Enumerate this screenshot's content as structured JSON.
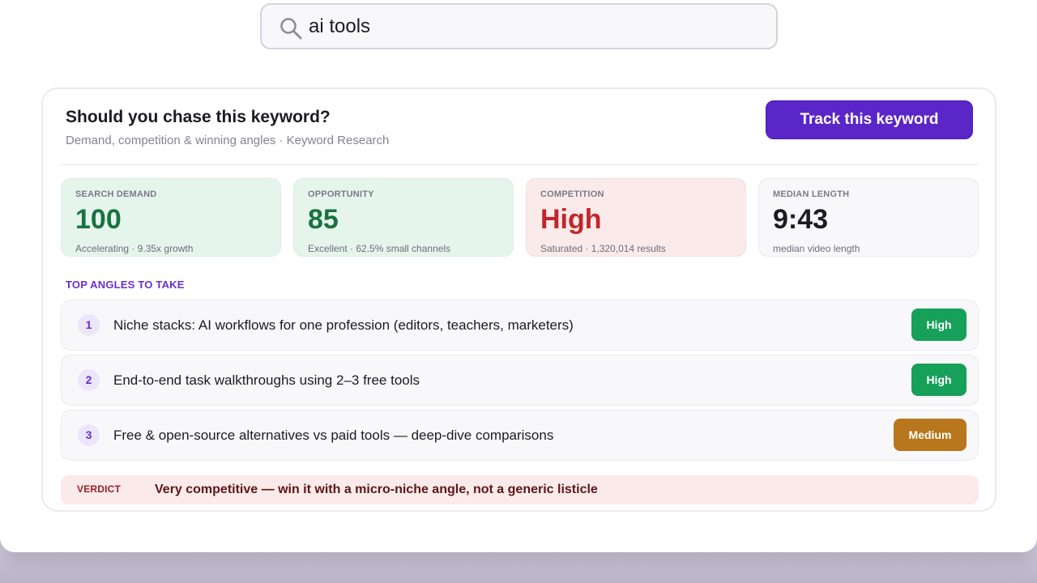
{
  "search": {
    "value": "ai tools",
    "icon": "search-icon"
  },
  "card": {
    "title": "Should you chase this keyword?",
    "subtitle": "Demand, competition & winning angles · Keyword Research",
    "track_button": "Track this keyword"
  },
  "metrics": [
    {
      "label": "SEARCH DEMAND",
      "value": "100",
      "sub": "Accelerating · 9.35x growth",
      "tone": "green"
    },
    {
      "label": "OPPORTUNITY",
      "value": "85",
      "sub": "Excellent · 62.5% small channels",
      "tone": "green"
    },
    {
      "label": "COMPETITION",
      "value": "High",
      "sub": "Saturated · 1,320,014 results",
      "tone": "red"
    },
    {
      "label": "MEDIAN LENGTH",
      "value": "9:43",
      "sub": "median video length",
      "tone": "neutral"
    }
  ],
  "angles": {
    "title": "TOP ANGLES TO TAKE",
    "items": [
      {
        "num": "1",
        "text": "Niche stacks: AI workflows for one profession (editors, teachers, marketers)",
        "badge": "High"
      },
      {
        "num": "2",
        "text": "End-to-end task walkthroughs using 2–3 free tools",
        "badge": "High"
      },
      {
        "num": "3",
        "text": "Free & open-source alternatives vs paid tools — deep-dive comparisons",
        "badge": "Medium"
      }
    ]
  },
  "verdict": {
    "label": "VERDICT",
    "text": "Very competitive — win it with a micro-niche angle, not a generic listicle"
  },
  "colors": {
    "accent": "#5a26c8",
    "positive": "#17733f",
    "negative": "#c0262c",
    "badge_high": "#16a05a",
    "badge_medium": "#b8771c"
  }
}
